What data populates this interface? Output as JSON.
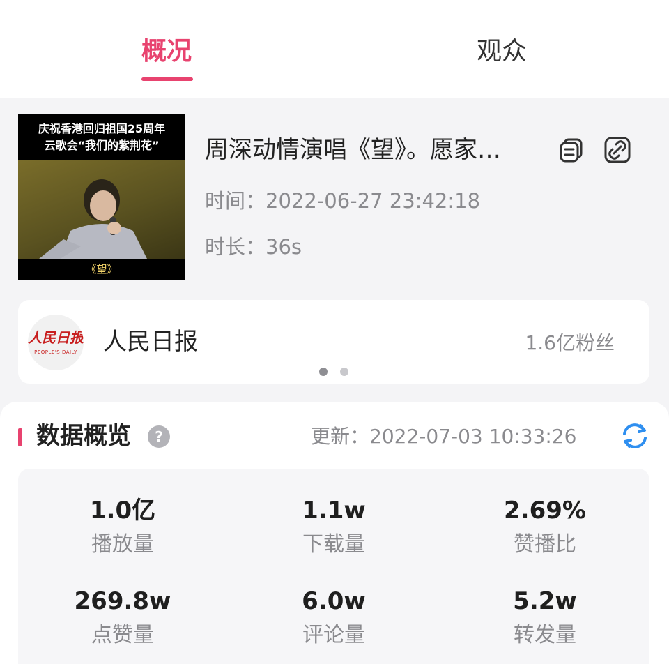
{
  "tabs": [
    {
      "label": "概况",
      "active": true
    },
    {
      "label": "观众",
      "active": false
    }
  ],
  "video": {
    "thumbnail_banner_line1": "庆祝香港回归祖国25周年",
    "thumbnail_banner_line2": "云歌会“我们的紫荆花”",
    "thumbnail_caption": "《望》",
    "title": "周深动情演唱《望》。愿家…",
    "time_label": "时间：",
    "time_value": "2022-06-27 23:42:18",
    "duration_label": "时长：",
    "duration_value": "36s",
    "icons": [
      "copy-icon",
      "link-icon"
    ]
  },
  "author": {
    "avatar_logo_text": "人民日报",
    "avatar_sub_text": "PEOPLE'S DAILY",
    "name": "人民日报",
    "fans": "1.6亿粉丝",
    "pager": {
      "total": 2,
      "current": 1
    }
  },
  "overview": {
    "title": "数据概览",
    "help_icon": "?",
    "update_label": "更新：",
    "update_value": "2022-07-03 10:33:26",
    "accent_color": "#e8436f",
    "refresh_color": "#2f8ff0",
    "stats": [
      {
        "value": "1.0亿",
        "label": "播放量"
      },
      {
        "value": "1.1w",
        "label": "下载量"
      },
      {
        "value": "2.69%",
        "label": "赞播比"
      },
      {
        "value": "269.8w",
        "label": "点赞量"
      },
      {
        "value": "6.0w",
        "label": "评论量"
      },
      {
        "value": "5.2w",
        "label": "转发量"
      }
    ]
  }
}
